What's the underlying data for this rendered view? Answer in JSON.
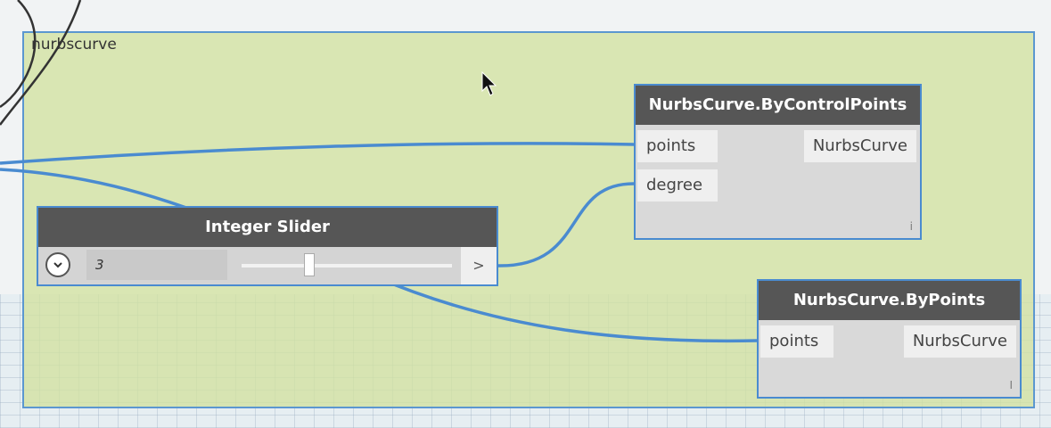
{
  "group": {
    "title": "nurbscurve"
  },
  "nodes": {
    "control_points": {
      "title": "NurbsCurve.ByControlPoints",
      "inputs": [
        "points",
        "degree"
      ],
      "output": "NurbsCurve",
      "corner_mark": "i"
    },
    "integer_slider": {
      "title": "Integer Slider",
      "value": "3",
      "next_label": ">",
      "expander_icon": "chevron-down-icon"
    },
    "by_points": {
      "title": "NurbsCurve.ByPoints",
      "inputs": [
        "points"
      ],
      "output": "NurbsCurve",
      "corner_mark": "I"
    }
  },
  "colors": {
    "wire": "#4a8bd0",
    "group_fill": "#d2e2a0",
    "group_border": "#5b97d0",
    "node_header": "#565656"
  }
}
